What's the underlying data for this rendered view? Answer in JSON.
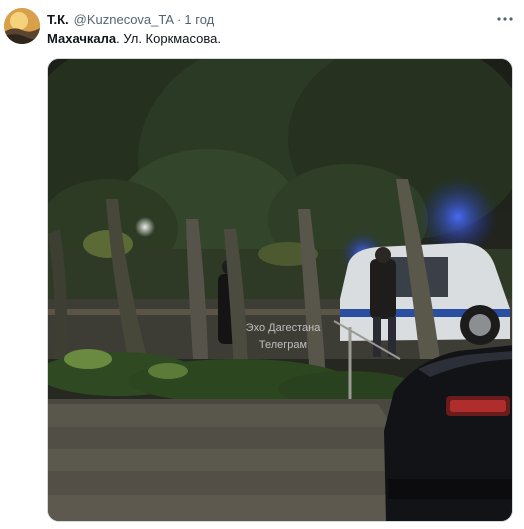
{
  "tweet": {
    "display_name": "Т.К.",
    "handle": "@Kuznecova_TA",
    "separator": "·",
    "time": "1 год",
    "text_bold": "Махачкала",
    "text_rest": ". Ул. Коркмасова."
  },
  "media": {
    "watermark_line1": "Эхо Дагестана",
    "watermark_line2": "Телеграм"
  },
  "icons": {
    "avatar": "avatar-image",
    "more": "more-options-icon"
  },
  "colors": {
    "text": "#0f1419",
    "secondary": "#536471",
    "border": "#cfd9de"
  }
}
